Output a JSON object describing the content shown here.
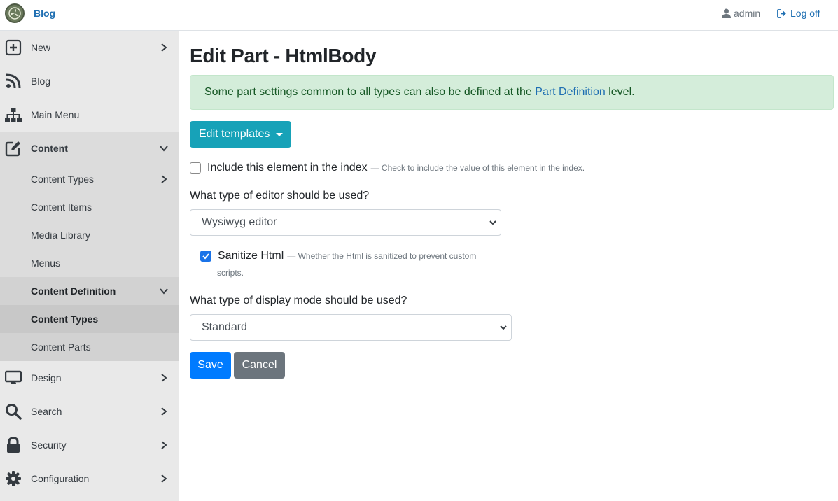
{
  "header": {
    "brand": "Blog",
    "user": "admin",
    "logoff": "Log off"
  },
  "sidebar": {
    "new": "New",
    "blog": "Blog",
    "main_menu": "Main Menu",
    "content": "Content",
    "content_sub": {
      "content_types": "Content Types",
      "content_items": "Content Items",
      "media_library": "Media Library",
      "menus": "Menus",
      "content_definition": "Content Definition",
      "def_content_types": "Content Types",
      "def_content_parts": "Content Parts"
    },
    "design": "Design",
    "search": "Search",
    "security": "Security",
    "configuration": "Configuration"
  },
  "main": {
    "title": "Edit Part - HtmlBody",
    "alert_before": "Some part settings common to all types can also be defined at the ",
    "alert_link": "Part Definition",
    "alert_after": " level.",
    "edit_templates": "Edit templates",
    "index_label": "Include this element in the index",
    "index_hint": "— Check to include the value of this element in the index.",
    "editor_question": "What type of editor should be used?",
    "editor_value": "Wysiwyg editor",
    "sanitize_label": "Sanitize Html",
    "sanitize_hint_1": "— Whether the Html is sanitized to prevent custom",
    "sanitize_hint_2": "scripts.",
    "display_question": "What type of display mode should be used?",
    "display_value": "Standard",
    "save": "Save",
    "cancel": "Cancel"
  },
  "colors": {
    "accent": "#17a2b8",
    "primary": "#007bff",
    "secondary": "#6c757d",
    "link": "#1f6fb2",
    "alert_bg": "#d4edda"
  }
}
